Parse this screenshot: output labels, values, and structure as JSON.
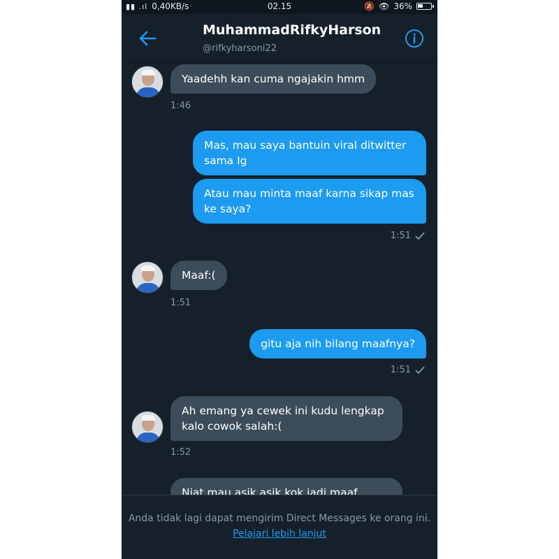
{
  "status": {
    "signal": "ℍ .▎┃ .┃",
    "speed": "0,40KB/s",
    "time": "02.15",
    "battery": "36%"
  },
  "header": {
    "name": "MuhammadRifkyHarson",
    "handle": "@rifkyharsoni22"
  },
  "messages": [
    {
      "text": "Yaadehh kan cuma ngajakin hmm",
      "time": "1:46"
    },
    {
      "text": "Mas, mau saya bantuin viral ditwitter sama Ig"
    },
    {
      "text": "Atau mau minta maaf karna sikap mas ke saya?",
      "time": "1:51"
    },
    {
      "text": "Maaf:(",
      "time": "1:51"
    },
    {
      "text": "gitu aja nih bilang maafnya?",
      "time": "1:51"
    },
    {
      "text": "Ah emang ya cewek ini kudu lengkap kalo cowok salah:(",
      "time": "1:52"
    },
    {
      "text": "Niat mau asik asik kok jadi maaf"
    }
  ],
  "footer": {
    "notice": "Anda tidak lagi dapat mengirim Direct Messages ke orang ini.",
    "link": "Pelajari lebih lanjut"
  },
  "colors": {
    "background": "#16202b",
    "received_bubble": "#3d4c5a",
    "sent_bubble": "#1d9bf0",
    "accent": "#1d9bf0"
  }
}
